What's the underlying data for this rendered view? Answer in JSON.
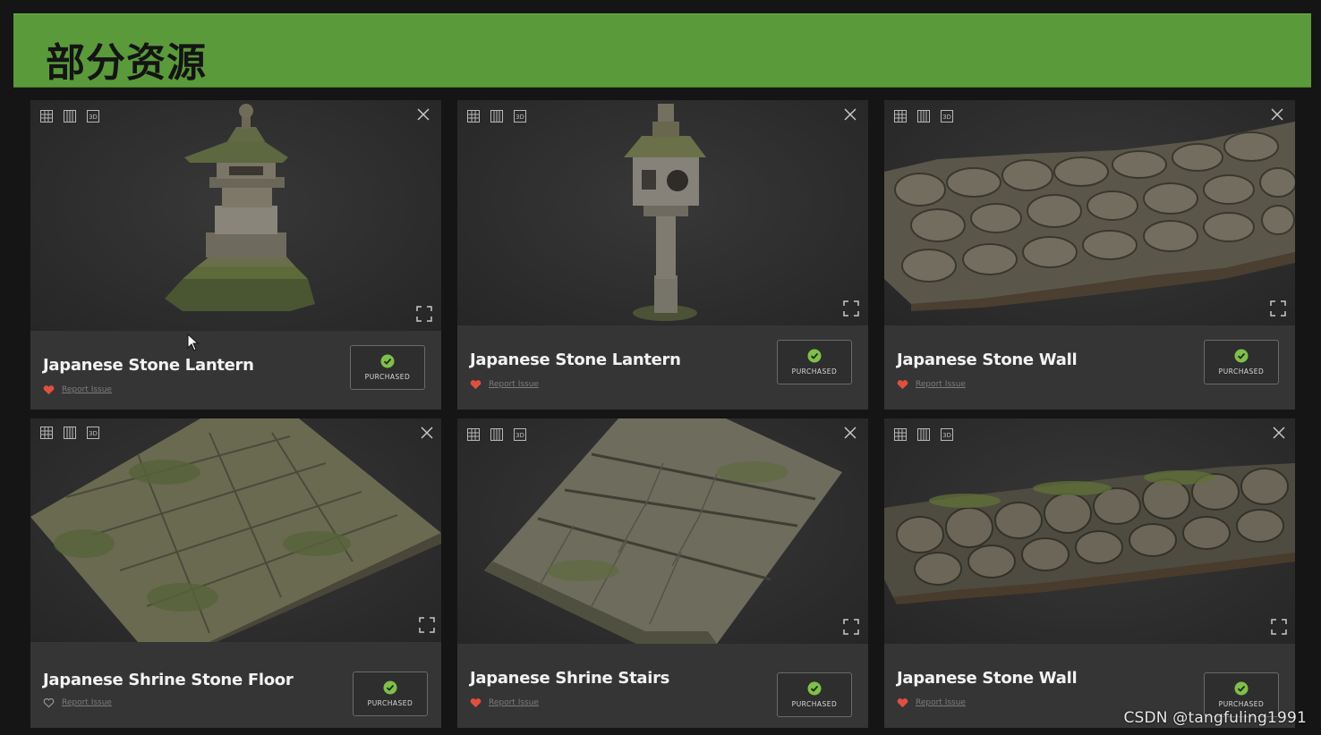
{
  "header": {
    "title": "部分资源"
  },
  "cards": [
    {
      "title": "Japanese Stone Lantern",
      "report": "Report Issue",
      "status": "PURCHASED",
      "favorited": true
    },
    {
      "title": "Japanese Stone Lantern",
      "report": "Report Issue",
      "status": "PURCHASED",
      "favorited": true
    },
    {
      "title": "Japanese Stone Wall",
      "report": "Report Issue",
      "status": "PURCHASED",
      "favorited": true
    },
    {
      "title": "Japanese Shrine Stone Floor",
      "report": "Report Issue",
      "status": "PURCHASED",
      "favorited": false
    },
    {
      "title": "Japanese Shrine Stairs",
      "report": "Report Issue",
      "status": "PURCHASED",
      "favorited": true
    },
    {
      "title": "Japanese Stone Wall",
      "report": "Report Issue",
      "status": "PURCHASED",
      "favorited": true
    }
  ],
  "toolbar_icons": [
    "grid-view-icon",
    "columns-view-icon",
    "3d-view-icon"
  ],
  "colors": {
    "header": "#5a9a3b",
    "heart": "#e0503e",
    "check": "#7fbf4a"
  },
  "watermark": "CSDN @tangfuling1991"
}
